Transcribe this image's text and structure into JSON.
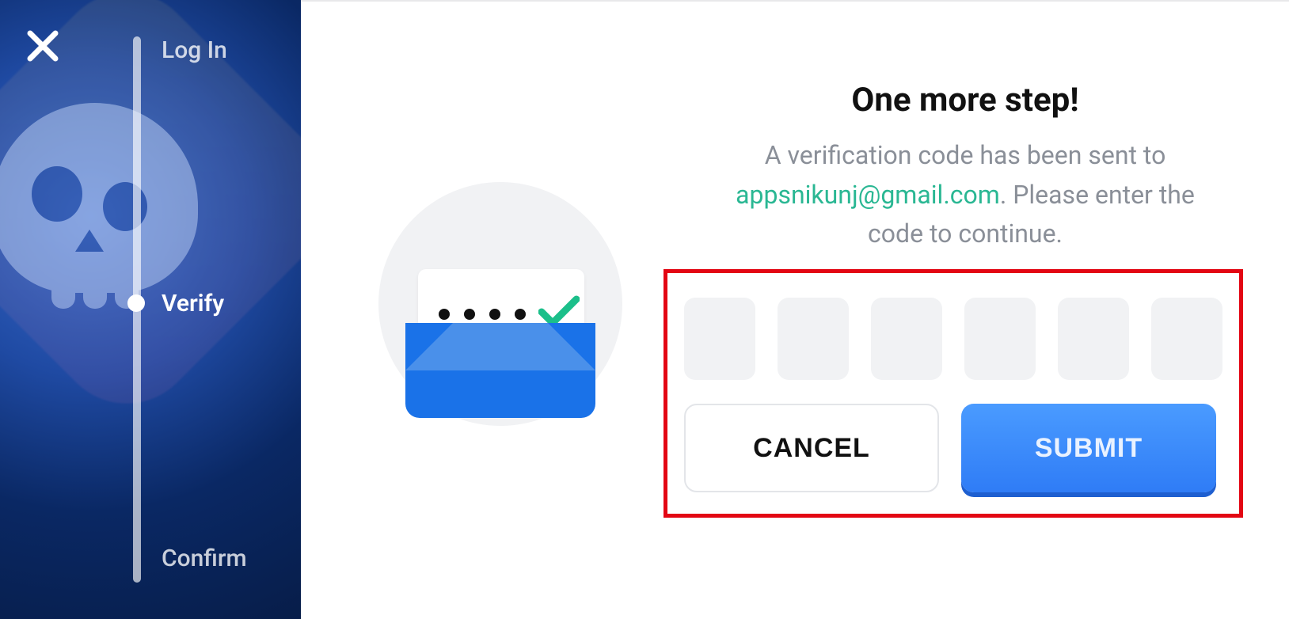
{
  "sidebar": {
    "steps": {
      "login": {
        "label": "Log In"
      },
      "verify": {
        "label": "Verify"
      },
      "confirm": {
        "label": "Confirm"
      }
    }
  },
  "verify": {
    "headline": "One more step!",
    "body_prefix": "A verification code has been sent to ",
    "email": "appsnikunj@gmail.com",
    "body_suffix": ". Please enter the code to continue.",
    "code_length": 6,
    "buttons": {
      "cancel": "CANCEL",
      "submit": "SUBMIT"
    }
  },
  "colors": {
    "accent_green": "#2ab793",
    "accent_blue": "#2f7cf6",
    "highlight_red": "#e30613"
  }
}
